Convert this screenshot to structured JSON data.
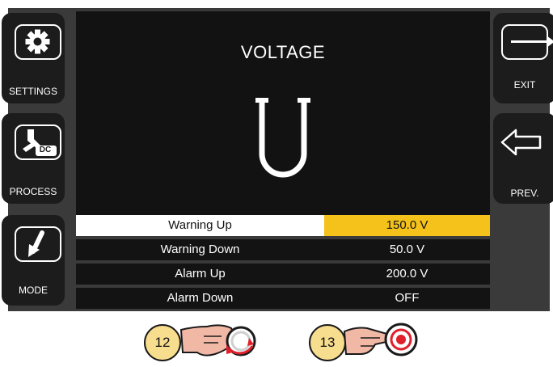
{
  "left_buttons": [
    {
      "label": "SETTINGS",
      "icon": "gear-icon"
    },
    {
      "label": "PROCESS",
      "icon": "welding-torch-dc-icon",
      "icon_text": "DC"
    },
    {
      "label": "MODE",
      "icon": "arrow-down-left-icon"
    }
  ],
  "right_buttons": [
    {
      "label": "EXIT",
      "icon": "exit-arrow-icon"
    },
    {
      "label": "PREV.",
      "icon": "arrow-left-icon"
    }
  ],
  "header": {
    "title": "VOLTAGE",
    "symbol": "U"
  },
  "table": {
    "rows": [
      {
        "name": "Warning Up",
        "value": "150.0 V",
        "selected": true
      },
      {
        "name": "Warning Down",
        "value": "50.0 V",
        "selected": false
      },
      {
        "name": "Alarm Up",
        "value": "200.0 V",
        "selected": false
      },
      {
        "name": "Alarm Down",
        "value": "OFF",
        "selected": false
      }
    ]
  },
  "controls": [
    {
      "badge": "12",
      "icon": "hand-rotate-knob-icon"
    },
    {
      "badge": "13",
      "icon": "hand-press-knob-icon"
    }
  ],
  "colors": {
    "highlight": "#f4c21b",
    "badge": "#f7dd8e",
    "panel": "#121212",
    "bezel": "#3a3a3a"
  }
}
